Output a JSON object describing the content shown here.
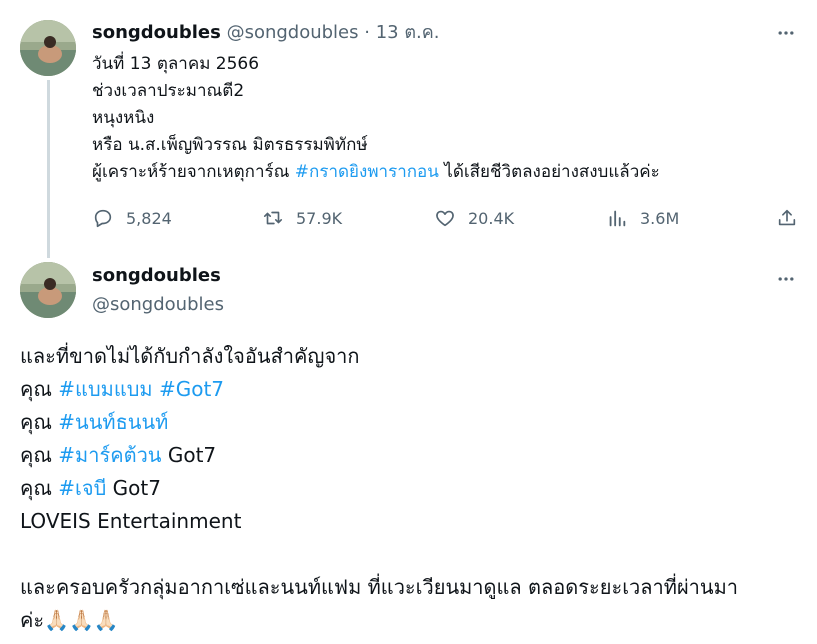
{
  "tweet1": {
    "name": "songdoubles",
    "handle": "@songdoubles",
    "separator": "·",
    "date": "13 ต.ค.",
    "lines": [
      "วันที่ 13 ตุลาคม 2566",
      "ช่วงเวลาประมาณตี2",
      "หนุงหนิง",
      "หรือ น.ส.เพ็ญพิวรรณ มิตรธรรมพิทักษ์"
    ],
    "line5": {
      "before": "ผู้เคราะห์ร้ายจากเหตุการ์ณ ",
      "hashtag": "#กราดยิงพารากอน",
      "after": " ได้เสียชีวิตลงอย่างสงบแล้วค่ะ"
    },
    "stats": {
      "replies": "5,824",
      "retweets": "57.9K",
      "likes": "20.4K",
      "views": "3.6M"
    }
  },
  "tweet2": {
    "name": "songdoubles",
    "handle": "@songdoubles",
    "line1": "และที่ขาดไม่ได้กับกำลังใจอันสำคัญจาก",
    "line2": {
      "prefix": "คุณ ",
      "tag1": "#แบมแบม",
      "space": " ",
      "tag2": "#Got7"
    },
    "line3": {
      "prefix": "คุณ ",
      "tag": "#นนท์ธนนท์"
    },
    "line4": {
      "prefix": "คุณ ",
      "tag": "#มาร์คต้วน",
      "suffix": " Got7"
    },
    "line5": {
      "prefix": "คุณ ",
      "tag": "#เจบี",
      "suffix": " Got7"
    },
    "line6": "LOVEIS Entertainment",
    "line7": "และครอบครัวกลุ่มอากาเซ่และนนท์แฟม ที่แวะเวียนมาดูแล ตลอดระยะเวลาที่ผ่านมา",
    "line8": {
      "text": "ค่ะ",
      "emojis": "🙏🏻🙏🏻🙏🏻"
    }
  },
  "colors": {
    "link": "#1d9bf0",
    "muted": "#536471",
    "text": "#0f1419",
    "thread_line": "#cfd9de"
  },
  "icons": [
    "more-icon",
    "reply-icon",
    "retweet-icon",
    "like-icon",
    "views-icon",
    "share-icon"
  ]
}
